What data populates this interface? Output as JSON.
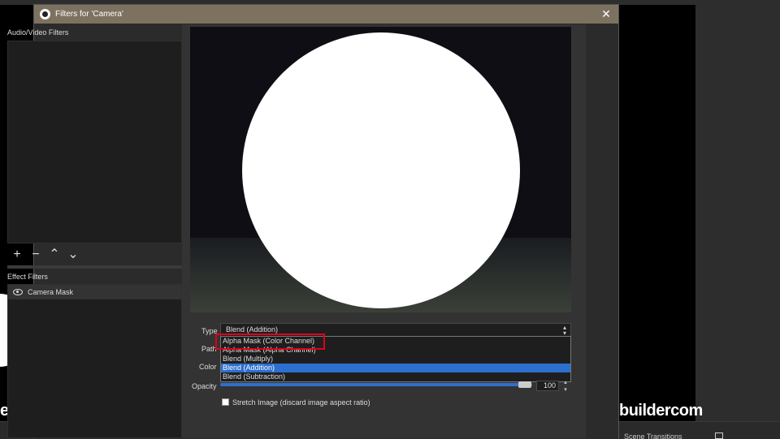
{
  "background": {
    "left_text": "eboo",
    "right_text": "buildercom",
    "scene_transitions_label": "Scene Transitions"
  },
  "dialog": {
    "title": "Filters for 'Camera'",
    "close_symbol": "✕",
    "audio_video_filters_label": "Audio/Video Filters",
    "toolbar": {
      "add_symbol": "+",
      "remove_symbol": "−",
      "up_symbol": "⌃",
      "down_symbol": "⌄"
    },
    "effect_filters_label": "Effect Filters",
    "effect_filters": [
      {
        "name": "Camera Mask",
        "icon": "eye-icon"
      }
    ],
    "properties": {
      "type_label": "Type",
      "type_value": "Blend (Addition)",
      "path_label": "Path",
      "color_label": "Color",
      "opacity_label": "Opacity",
      "opacity_value": "100",
      "opacity_level_percent": 100,
      "stretch_label": "Stretch Image (discard image aspect ratio)",
      "stretch_checked": false
    },
    "type_options": [
      "Alpha Mask (Color Channel)",
      "Alpha Mask (Alpha Channel)",
      "Blend (Multiply)",
      "Blend (Addition)",
      "Blend (Subtraction)"
    ],
    "selected_option_index": 3
  },
  "colors": {
    "titlebar": "#7d7160",
    "selection": "#2c6fcf",
    "highlight_box": "#e0001b"
  }
}
